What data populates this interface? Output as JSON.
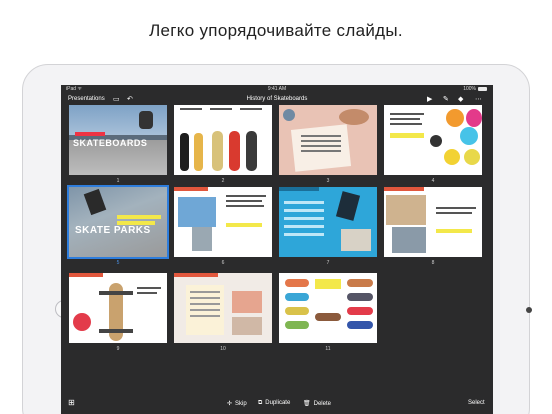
{
  "headline": "Легко упорядочивайте слайды.",
  "status": {
    "left": "iPad ᯤ",
    "time": "9:41 AM",
    "battery": "100%"
  },
  "toolbar": {
    "back_label": "Presentations",
    "title": "History of Skateboards",
    "icons": [
      "sidebar-icon",
      "undo-icon",
      "play-icon",
      "format-icon",
      "share-icon",
      "more-icon"
    ]
  },
  "slides": [
    {
      "number": "1",
      "caption": "SKATEBOARDS",
      "selected": false
    },
    {
      "number": "2",
      "caption": "",
      "selected": false
    },
    {
      "number": "3",
      "caption": "",
      "selected": false
    },
    {
      "number": "4",
      "caption": "",
      "selected": false
    },
    {
      "number": "5",
      "caption": "SKATE PARKS",
      "selected": true
    },
    {
      "number": "6",
      "caption": "",
      "selected": false
    },
    {
      "number": "7",
      "caption": "",
      "selected": false
    },
    {
      "number": "8",
      "caption": "",
      "selected": false
    },
    {
      "number": "9",
      "caption": "",
      "selected": false
    },
    {
      "number": "10",
      "caption": "",
      "selected": false
    },
    {
      "number": "11",
      "caption": "",
      "selected": false
    }
  ],
  "bottom": {
    "skip_label": "Skip",
    "duplicate_label": "Duplicate",
    "delete_label": "Delete",
    "select_label": "Select"
  },
  "colors": {
    "accent": "#2e7ddc",
    "screen_bg": "#2b2b2c"
  }
}
